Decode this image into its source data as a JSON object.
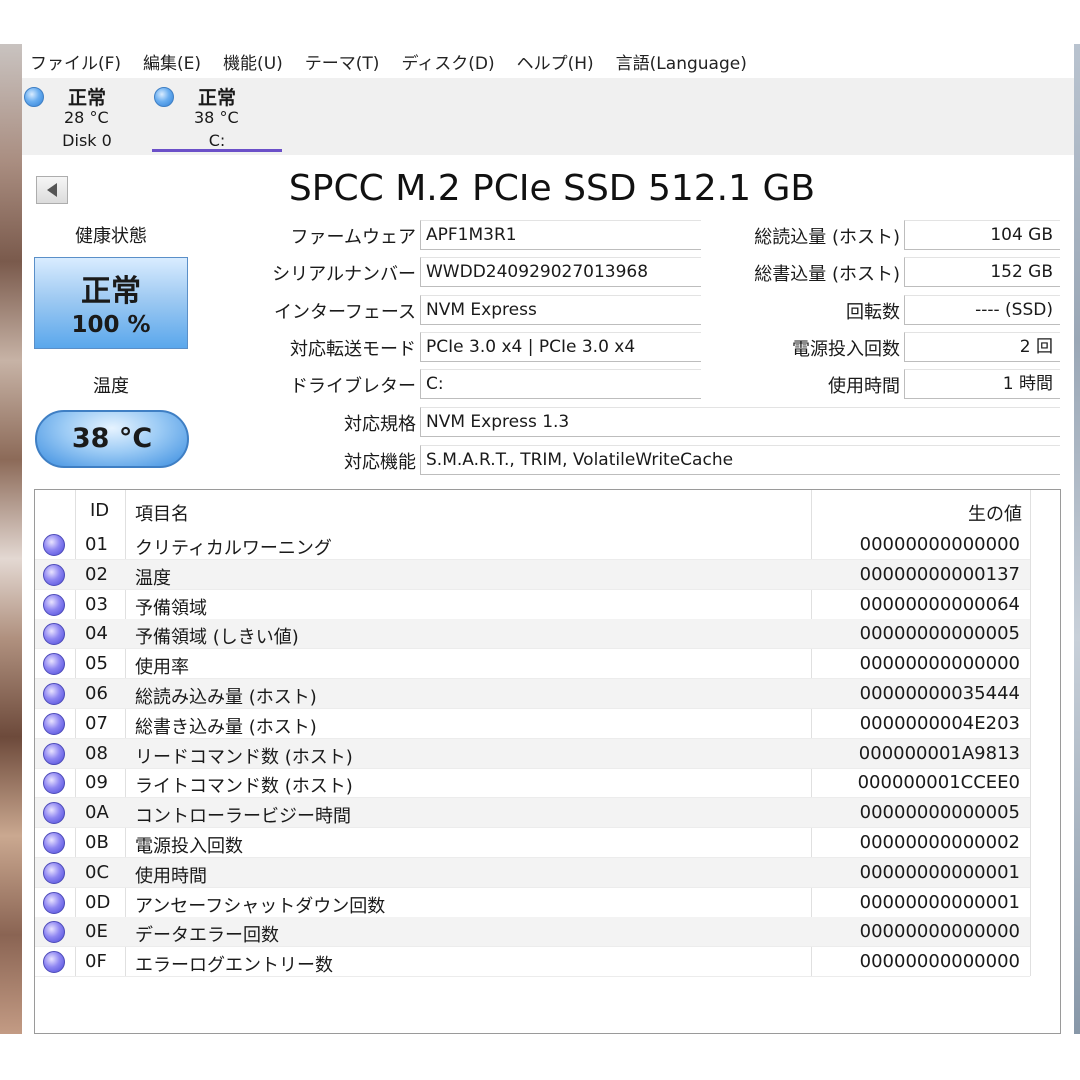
{
  "menu": [
    "ファイル(F)",
    "編集(E)",
    "機能(U)",
    "テーマ(T)",
    "ディスク(D)",
    "ヘルプ(H)",
    "言語(Language)"
  ],
  "disks": [
    {
      "status": "正常",
      "temp": "28 °C",
      "name": "Disk 0"
    },
    {
      "status": "正常",
      "temp": "38 °C",
      "name": "C:"
    }
  ],
  "title": "SPCC M.2 PCIe SSD 512.1 GB",
  "health": {
    "label": "健康状態",
    "status": "正常",
    "percent": "100 %"
  },
  "temperature": {
    "label": "温度",
    "value": "38 °C"
  },
  "info_left": [
    {
      "label": "ファームウェア",
      "value": "APF1M3R1"
    },
    {
      "label": "シリアルナンバー",
      "value": "WWDD240929027013968"
    },
    {
      "label": "インターフェース",
      "value": "NVM Express"
    },
    {
      "label": "対応転送モード",
      "value": "PCIe 3.0 x4 | PCIe 3.0 x4"
    },
    {
      "label": "ドライブレター",
      "value": "C:"
    },
    {
      "label": "対応規格",
      "value": "NVM Express 1.3"
    },
    {
      "label": "対応機能",
      "value": "S.M.A.R.T., TRIM, VolatileWriteCache"
    }
  ],
  "info_right": [
    {
      "label": "総読込量 (ホスト)",
      "value": "104 GB"
    },
    {
      "label": "総書込量 (ホスト)",
      "value": "152 GB"
    },
    {
      "label": "回転数",
      "value": "---- (SSD)"
    },
    {
      "label": "電源投入回数",
      "value": "2 回"
    },
    {
      "label": "使用時間",
      "value": "1 時間"
    }
  ],
  "smart": {
    "headers": {
      "id": "ID",
      "name": "項目名",
      "raw": "生の値"
    },
    "rows": [
      {
        "id": "01",
        "name": "クリティカルワーニング",
        "raw": "00000000000000"
      },
      {
        "id": "02",
        "name": "温度",
        "raw": "00000000000137"
      },
      {
        "id": "03",
        "name": "予備領域",
        "raw": "00000000000064"
      },
      {
        "id": "04",
        "name": "予備領域 (しきい値)",
        "raw": "00000000000005"
      },
      {
        "id": "05",
        "name": "使用率",
        "raw": "00000000000000"
      },
      {
        "id": "06",
        "name": "総読み込み量 (ホスト)",
        "raw": "00000000035444"
      },
      {
        "id": "07",
        "name": "総書き込み量 (ホスト)",
        "raw": "0000000004E203"
      },
      {
        "id": "08",
        "name": "リードコマンド数 (ホスト)",
        "raw": "000000001A9813"
      },
      {
        "id": "09",
        "name": "ライトコマンド数 (ホスト)",
        "raw": "000000001CCEE0"
      },
      {
        "id": "0A",
        "name": "コントローラービジー時間",
        "raw": "00000000000005"
      },
      {
        "id": "0B",
        "name": "電源投入回数",
        "raw": "00000000000002"
      },
      {
        "id": "0C",
        "name": "使用時間",
        "raw": "00000000000001"
      },
      {
        "id": "0D",
        "name": "アンセーフシャットダウン回数",
        "raw": "00000000000001"
      },
      {
        "id": "0E",
        "name": "データエラー回数",
        "raw": "00000000000000"
      },
      {
        "id": "0F",
        "name": "エラーログエントリー数",
        "raw": "00000000000000"
      }
    ]
  }
}
